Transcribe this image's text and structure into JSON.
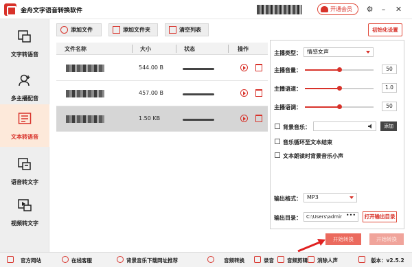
{
  "app": {
    "title": "金舟文字语音转换软件"
  },
  "titlebar": {
    "vip_label": "开通会员"
  },
  "sidebar": {
    "items": [
      {
        "label": "文字转语音",
        "icon": "text-to-speech-icon",
        "active": false
      },
      {
        "label": "多主播配音",
        "icon": "multi-voice-icon",
        "active": false
      },
      {
        "label": "文本转语音",
        "icon": "document-to-speech-icon",
        "active": true
      },
      {
        "label": "语音转文字",
        "icon": "speech-to-text-icon",
        "active": false
      },
      {
        "label": "视频转文字",
        "icon": "video-to-text-icon",
        "active": false
      }
    ]
  },
  "toolbar": {
    "add_file": "添加文件",
    "add_folder": "添加文件夹",
    "clear_list": "清空列表",
    "reset_settings": "初始化设置"
  },
  "table": {
    "headers": {
      "name": "文件名称",
      "size": "大小",
      "status": "状态",
      "action": "操作"
    },
    "rows": [
      {
        "size": "544.00 B",
        "selected": false
      },
      {
        "size": "457.00 B",
        "selected": false
      },
      {
        "size": "1.50 KB",
        "selected": true
      }
    ]
  },
  "settings": {
    "voice_type_label": "主播类型：",
    "voice_type_value": "情感女声",
    "volume_label": "主播音量：",
    "volume_value": "50",
    "speed_label": "主播语速：",
    "speed_value": "1.0",
    "pitch_label": "主播语调：",
    "pitch_value": "50",
    "bgm_label": "背景音乐：",
    "add_label": "添加",
    "loop_label": "音乐循环至文本结束",
    "lower_label": "文本朗读时背景音乐小声",
    "format_label": "输出格式：",
    "format_value": "MP3",
    "output_dir_label": "输出目录：",
    "output_dir_value": "C:\\Users\\admir",
    "dots": "•••",
    "open_dir": "打开输出目录"
  },
  "actions": {
    "start": "开始转换",
    "stop": "开始转换"
  },
  "footer": {
    "website": "官方网站",
    "service": "在线客服",
    "bgm_download": "背景音乐下载网址推荐",
    "audio_convert": "音频转换",
    "record": "录音",
    "audio_cut": "音频剪辑",
    "vocal_remove": "消除人声",
    "version": "版本：v2.5.2"
  },
  "colors": {
    "accent": "#d8322a",
    "active_bg": "#fde9da",
    "sidebar_bg": "#eeeeee"
  }
}
